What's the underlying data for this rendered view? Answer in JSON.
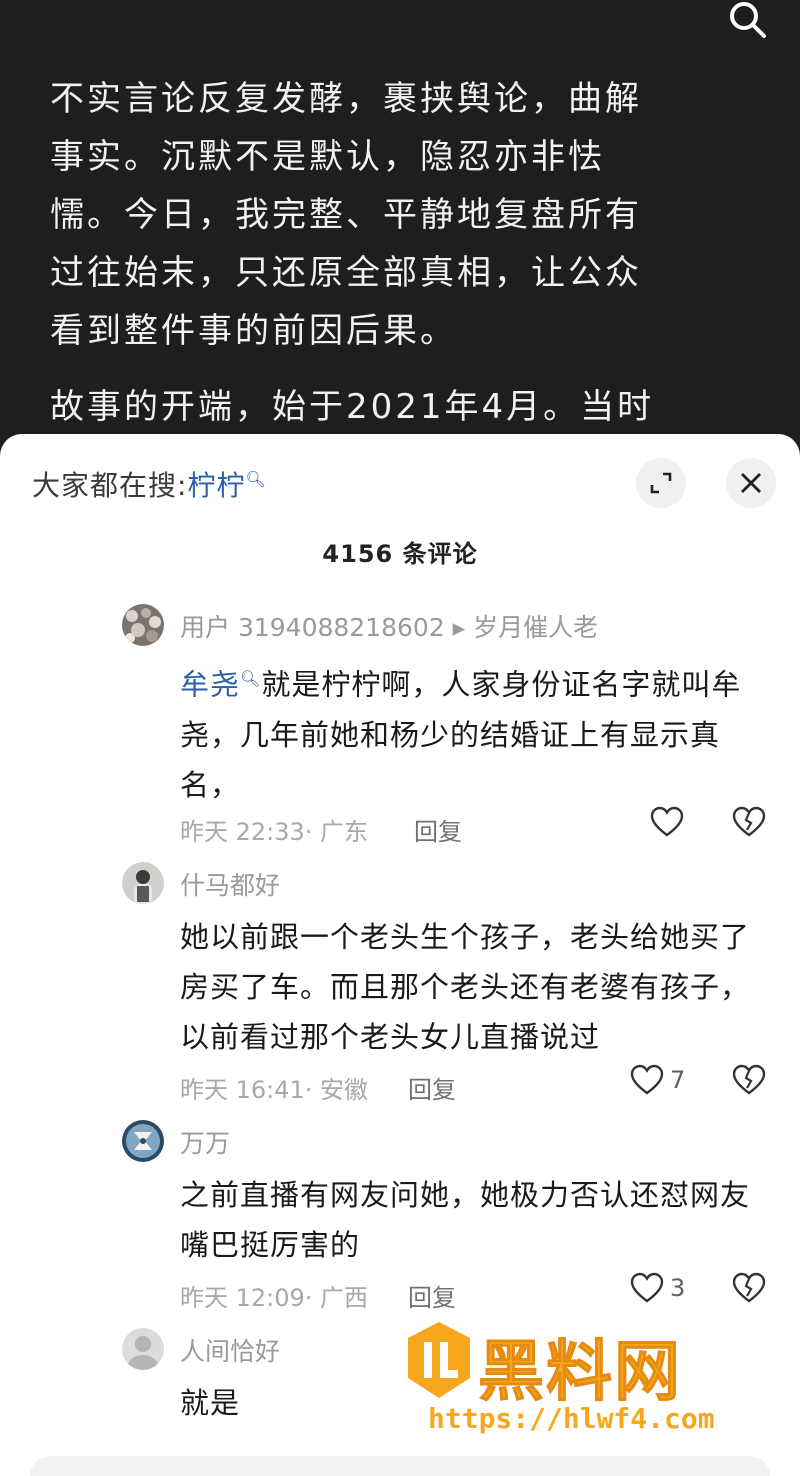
{
  "article": {
    "paragraphs": [
      "不实言论反复发酵，裹挟舆论，曲解事实。沉默不是默认，隐忍亦非怯懦。今日，我完整、平静地复盘所有过往始末，只还原全部真相，让公众看到整件事的前因后果。",
      "故事的开端，始于2021年4月。当时她"
    ]
  },
  "sheet": {
    "hot_search_prefix": "大家都在搜:",
    "hot_search_keyword": "柠柠",
    "comment_count": "4156 条评论"
  },
  "comments": [
    {
      "user": "用户 3194088218602 ▸ 岁月催人老",
      "mention": "牟尧",
      "text": "就是柠柠啊，人家身份证名字就叫牟尧，几年前她和杨少的结婚证上有显示真名，",
      "meta": "昨天 22:33· 广东",
      "reply": "回复",
      "likes": ""
    },
    {
      "user": "什马都好",
      "mention": "",
      "text": "她以前跟一个老头生个孩子，老头给她买了房买了车。而且那个老头还有老婆有孩子，以前看过那个老头女儿直播说过",
      "meta": "昨天 16:41· 安徽",
      "reply": "回复",
      "likes": "7"
    },
    {
      "user": "万万",
      "mention": "",
      "text": "之前直播有网友问她，她极力否认还怼网友嘴巴挺厉害的",
      "meta": "昨天 12:09· 广西",
      "reply": "回复",
      "likes": "3"
    },
    {
      "user": "人间恰好",
      "mention": "",
      "text": "就是",
      "meta": "",
      "reply": "",
      "likes": ""
    }
  ],
  "watermark": {
    "logo_text": "黑料网",
    "url": "https://hlwf4.com"
  },
  "colors": {
    "link": "#2a5fa8",
    "watermark": "#f7a71e"
  }
}
